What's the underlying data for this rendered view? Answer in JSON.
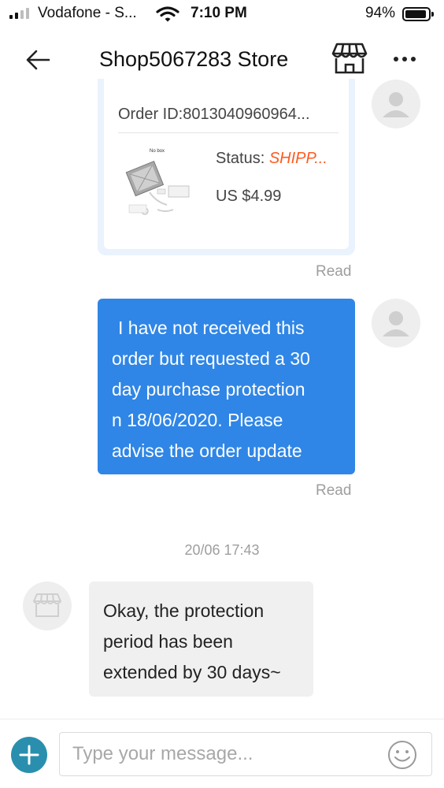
{
  "status_bar": {
    "carrier": "Vodafone - S...",
    "time": "7:10 PM",
    "battery_percent": "94%",
    "signal_bars_active": 2,
    "signal_bars_total": 4,
    "battery_level": 0.94
  },
  "header": {
    "title": "Shop5067283 Store",
    "back_icon": "arrow-left-icon",
    "store_icon": "storefront-icon",
    "more_icon": "more-dots-icon"
  },
  "messages": {
    "order_card": {
      "order_id": "Order ID:8013040960964...",
      "status_label": "Status: ",
      "status_value": "SHIPP...",
      "price": "US $4.99",
      "read": "Read"
    },
    "outgoing_text": {
      "lines": [
        "I have not received this",
        "order but requested a 30",
        "day purchase protection",
        "n 18/06/2020. Please",
        "advise the order update"
      ],
      "read": "Read"
    },
    "timestamp": "20/06 17:43",
    "incoming_text": {
      "lines": [
        "Okay, the protection",
        "period has been",
        "extended by 30 days~"
      ]
    }
  },
  "input_bar": {
    "placeholder": "Type your message...",
    "add_icon": "plus-icon",
    "emoji_icon": "smiley-icon"
  },
  "colors": {
    "outgoing_bubble": "#2f86e6",
    "incoming_bubble": "#f0f0f0",
    "status_accent": "#ff5a1f",
    "add_button": "#2a8fae"
  }
}
